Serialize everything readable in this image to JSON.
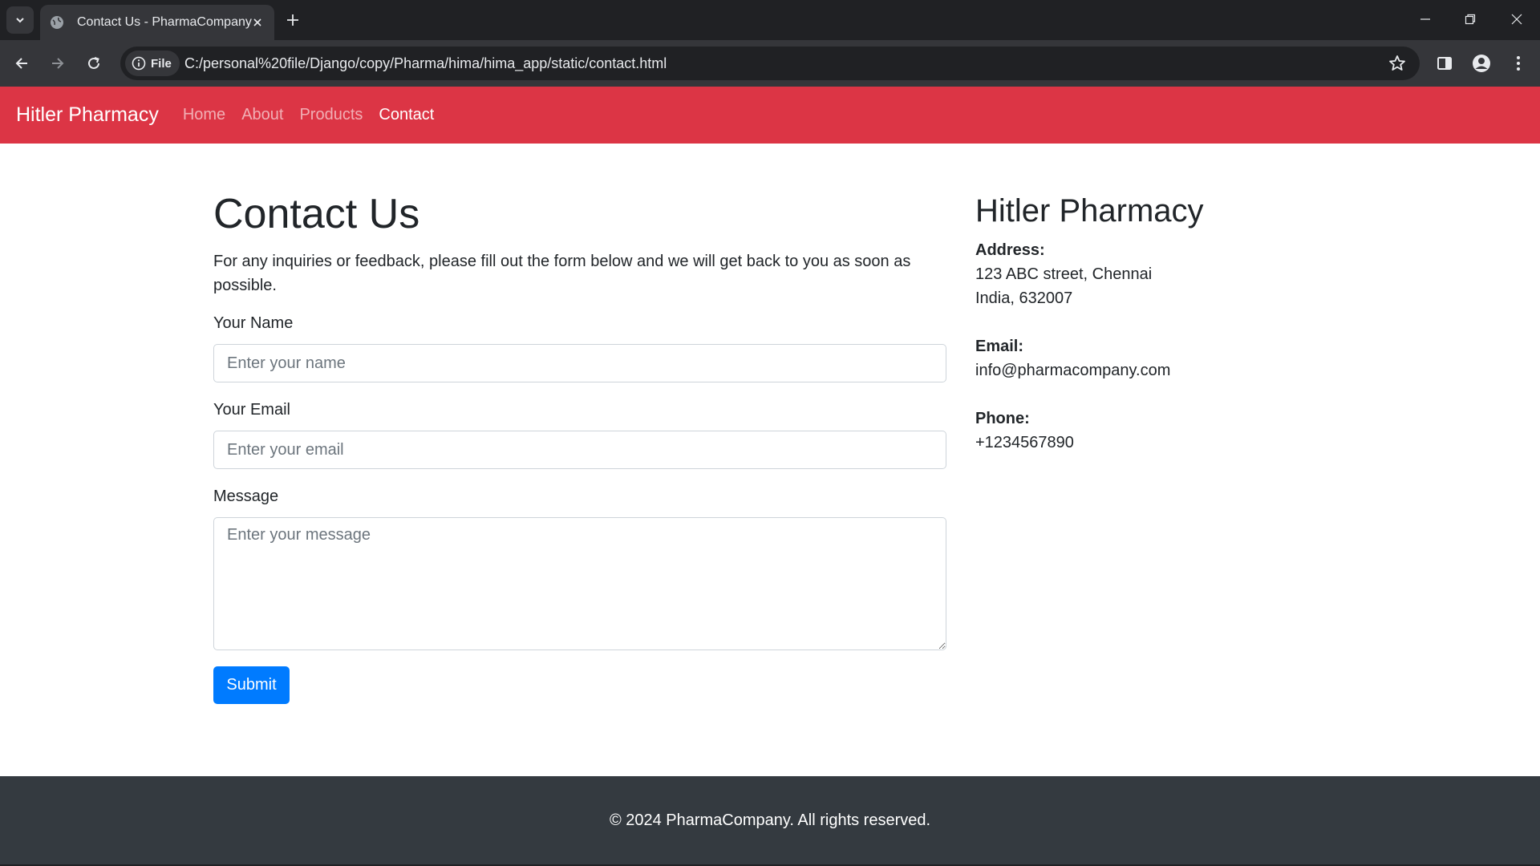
{
  "browser": {
    "tab_title": "Contact Us - PharmaCompany",
    "site_chip_label": "File",
    "url": "C:/personal%20file/Django/copy/Pharma/hima/hima_app/static/contact.html"
  },
  "navbar": {
    "brand": "Hitler Pharmacy",
    "links": [
      {
        "label": "Home",
        "active": false
      },
      {
        "label": "About",
        "active": false
      },
      {
        "label": "Products",
        "active": false
      },
      {
        "label": "Contact",
        "active": true
      }
    ]
  },
  "contact_form": {
    "title": "Contact Us",
    "intro": "For any inquiries or feedback, please fill out the form below and we will get back to you as soon as possible.",
    "name_label": "Your Name",
    "name_placeholder": "Enter your name",
    "email_label": "Your Email",
    "email_placeholder": "Enter your email",
    "message_label": "Message",
    "message_placeholder": "Enter your message",
    "submit_label": "Submit"
  },
  "sidebar": {
    "title": "Hitler Pharmacy",
    "address_label": "Address:",
    "address_line1": "123 ABC street, Chennai",
    "address_line2": "India, 632007",
    "email_label": "Email:",
    "email_value": "info@pharmacompany.com",
    "phone_label": "Phone:",
    "phone_value": "+1234567890"
  },
  "footer": {
    "text": "© 2024 PharmaCompany. All rights reserved."
  },
  "colors": {
    "navbar": "#dc3545",
    "primary_button": "#007bff",
    "footer": "#343a40"
  }
}
